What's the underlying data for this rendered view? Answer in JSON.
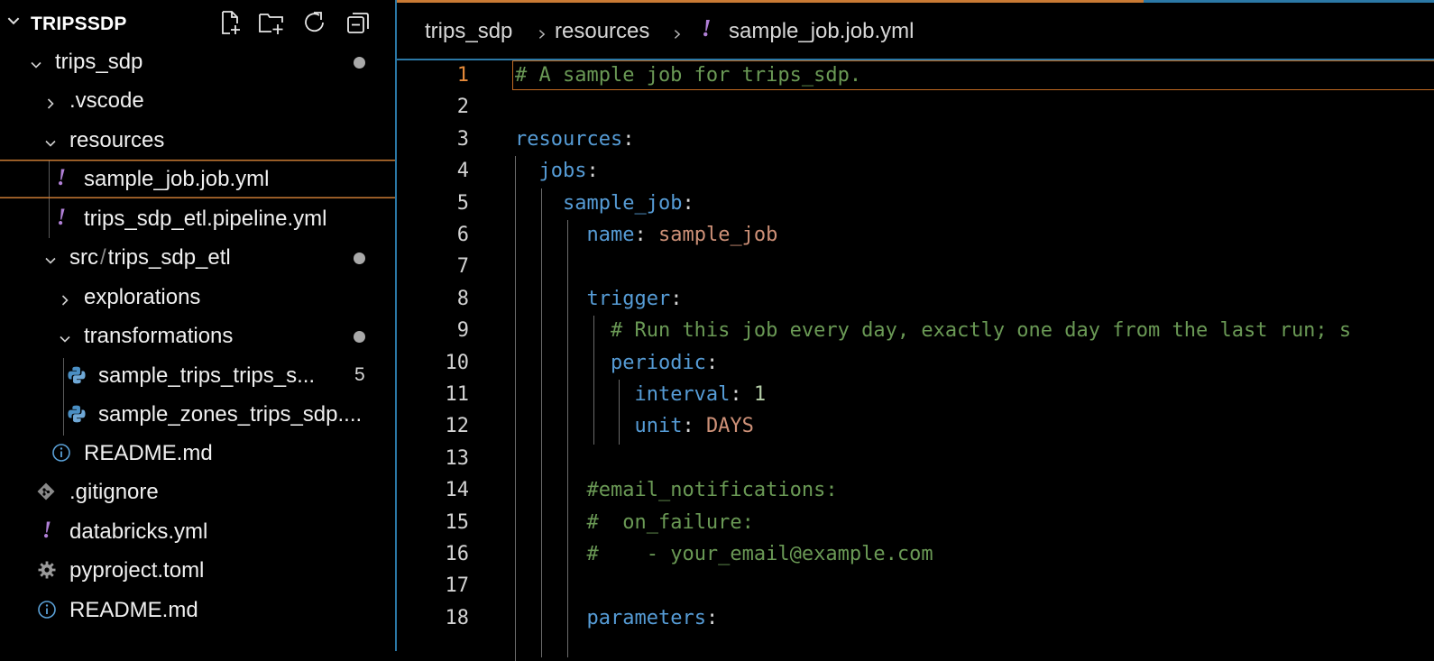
{
  "explorer": {
    "title": "TRIPSSDP",
    "actions": [
      {
        "name": "new-file-icon"
      },
      {
        "name": "new-folder-icon"
      },
      {
        "name": "refresh-icon"
      },
      {
        "name": "collapse-all-icon"
      }
    ],
    "tree": [
      {
        "label": "trips_sdp",
        "type": "folder",
        "expanded": true,
        "depth": 0,
        "modified_dot": true
      },
      {
        "label": ".vscode",
        "type": "folder",
        "expanded": false,
        "depth": 1
      },
      {
        "label": "resources",
        "type": "folder",
        "expanded": true,
        "depth": 1
      },
      {
        "label": "sample_job.job.yml",
        "type": "yml",
        "depth": 2,
        "selected": true,
        "icon": "!"
      },
      {
        "label": "trips_sdp_etl.pipeline.yml",
        "type": "yml",
        "depth": 2,
        "icon": "!"
      },
      {
        "label": "src",
        "label2": "trips_sdp_etl",
        "type": "folder",
        "expanded": true,
        "depth": 1,
        "modified_dot": true
      },
      {
        "label": "explorations",
        "type": "folder",
        "expanded": false,
        "depth": 2
      },
      {
        "label": "transformations",
        "type": "folder",
        "expanded": true,
        "depth": 2,
        "modified_dot": true
      },
      {
        "label": "sample_trips_trips_s...",
        "type": "python",
        "depth": 3,
        "badge": "5"
      },
      {
        "label": "sample_zones_trips_sdp....",
        "type": "python",
        "depth": 3
      },
      {
        "label": "README.md",
        "type": "info",
        "depth": 2
      },
      {
        "label": ".gitignore",
        "type": "git",
        "depth": 1
      },
      {
        "label": "databricks.yml",
        "type": "yml",
        "depth": 1,
        "icon": "!"
      },
      {
        "label": "pyproject.toml",
        "type": "gear",
        "depth": 1
      },
      {
        "label": "README.md",
        "type": "info",
        "depth": 1
      }
    ]
  },
  "breadcrumb": {
    "parts": [
      "trips_sdp",
      "resources",
      "sample_job.job.yml"
    ],
    "file_icon": "!"
  },
  "editor": {
    "active_line": 1,
    "lines": [
      {
        "n": "1",
        "tokens": [
          [
            "comment",
            "# A sample job for trips_sdp."
          ]
        ]
      },
      {
        "n": "2",
        "tokens": []
      },
      {
        "n": "3",
        "tokens": [
          [
            "key",
            "resources"
          ],
          [
            "punct",
            ":"
          ]
        ]
      },
      {
        "n": "4",
        "tokens": [
          [
            "ws",
            "  "
          ],
          [
            "key",
            "jobs"
          ],
          [
            "punct",
            ":"
          ]
        ]
      },
      {
        "n": "5",
        "tokens": [
          [
            "ws",
            "    "
          ],
          [
            "key",
            "sample_job"
          ],
          [
            "punct",
            ":"
          ]
        ]
      },
      {
        "n": "6",
        "tokens": [
          [
            "ws",
            "      "
          ],
          [
            "key",
            "name"
          ],
          [
            "punct",
            ": "
          ],
          [
            "str",
            "sample_job"
          ]
        ]
      },
      {
        "n": "7",
        "tokens": []
      },
      {
        "n": "8",
        "tokens": [
          [
            "ws",
            "      "
          ],
          [
            "key",
            "trigger"
          ],
          [
            "punct",
            ":"
          ]
        ]
      },
      {
        "n": "9",
        "tokens": [
          [
            "ws",
            "        "
          ],
          [
            "comment",
            "# Run this job every day, exactly one day from the last run; s"
          ]
        ]
      },
      {
        "n": "10",
        "tokens": [
          [
            "ws",
            "        "
          ],
          [
            "key",
            "periodic"
          ],
          [
            "punct",
            ":"
          ]
        ]
      },
      {
        "n": "11",
        "tokens": [
          [
            "ws",
            "          "
          ],
          [
            "key",
            "interval"
          ],
          [
            "punct",
            ": "
          ],
          [
            "num",
            "1"
          ]
        ]
      },
      {
        "n": "12",
        "tokens": [
          [
            "ws",
            "          "
          ],
          [
            "key",
            "unit"
          ],
          [
            "punct",
            ": "
          ],
          [
            "str",
            "DAYS"
          ]
        ]
      },
      {
        "n": "13",
        "tokens": []
      },
      {
        "n": "14",
        "tokens": [
          [
            "ws",
            "      "
          ],
          [
            "comment",
            "#email_notifications:"
          ]
        ]
      },
      {
        "n": "15",
        "tokens": [
          [
            "ws",
            "      "
          ],
          [
            "comment",
            "#  on_failure:"
          ]
        ]
      },
      {
        "n": "16",
        "tokens": [
          [
            "ws",
            "      "
          ],
          [
            "comment",
            "#    - your_email@example.com"
          ]
        ]
      },
      {
        "n": "17",
        "tokens": []
      },
      {
        "n": "18",
        "tokens": [
          [
            "ws",
            "      "
          ],
          [
            "key",
            "parameters"
          ],
          [
            "punct",
            ":"
          ]
        ]
      }
    ]
  },
  "colors": {
    "accent_orange": "#c97a34",
    "accent_blue": "#2b78a6",
    "comment": "#6a9955",
    "key": "#569cd6",
    "string": "#ce9178",
    "number": "#b5cea8",
    "yml_icon": "#b180d7",
    "python_icon": "#4a8fc4"
  }
}
